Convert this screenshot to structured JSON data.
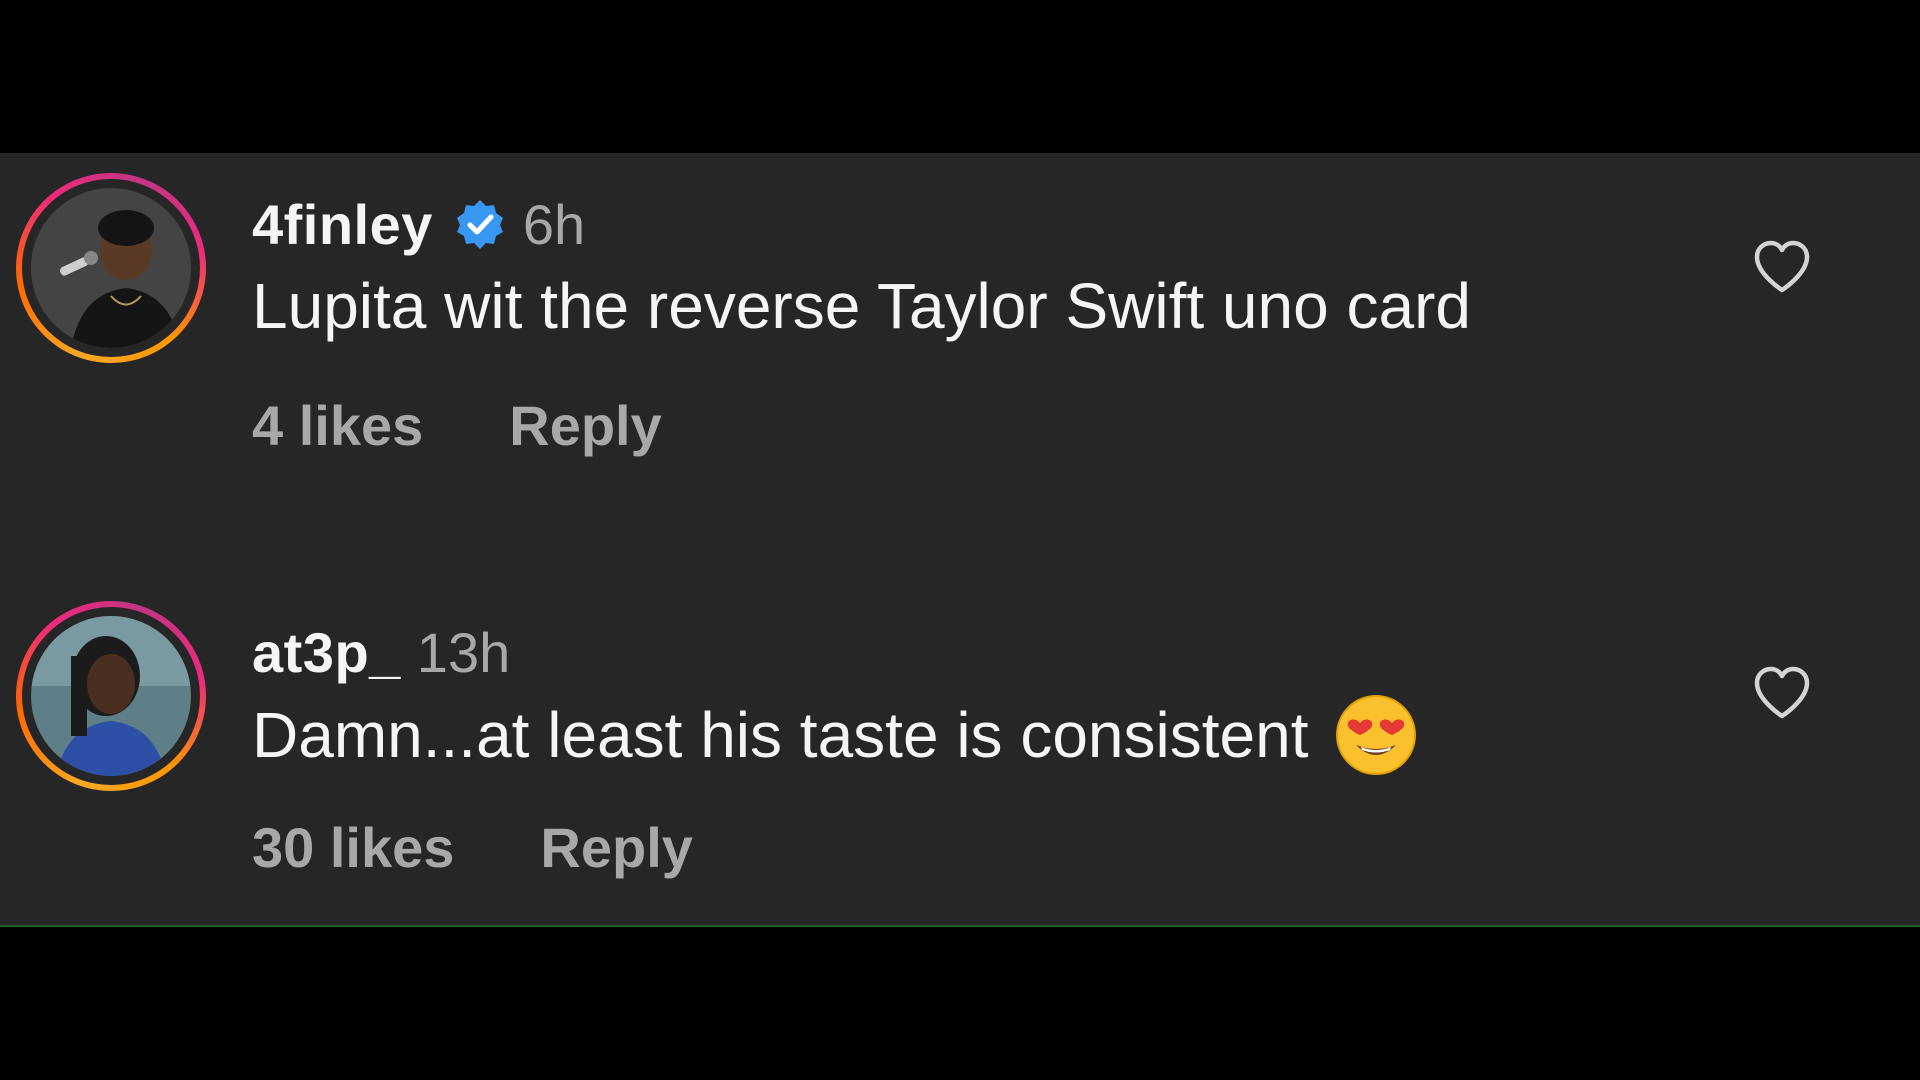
{
  "comments": [
    {
      "username": "4finley",
      "verified": true,
      "time": "6h",
      "text": "Lupita wit the reverse Taylor Swift uno card",
      "emoji": "",
      "likes": "4 likes",
      "reply_label": "Reply",
      "avatar_icon": "person-with-microphone-photo"
    },
    {
      "username": "at3p_",
      "verified": false,
      "time": "13h",
      "text": "Damn...at least his taste is consistent",
      "emoji": "heart-eyes-emoji",
      "likes": "30 likes",
      "reply_label": "Reply",
      "avatar_icon": "woman-in-car-photo"
    }
  ],
  "colors": {
    "background": "#262626",
    "letterbox": "#000000",
    "primary_text": "#f5f5f5",
    "secondary_text": "#a8a8a8",
    "verified_badge": "#3897f0"
  }
}
